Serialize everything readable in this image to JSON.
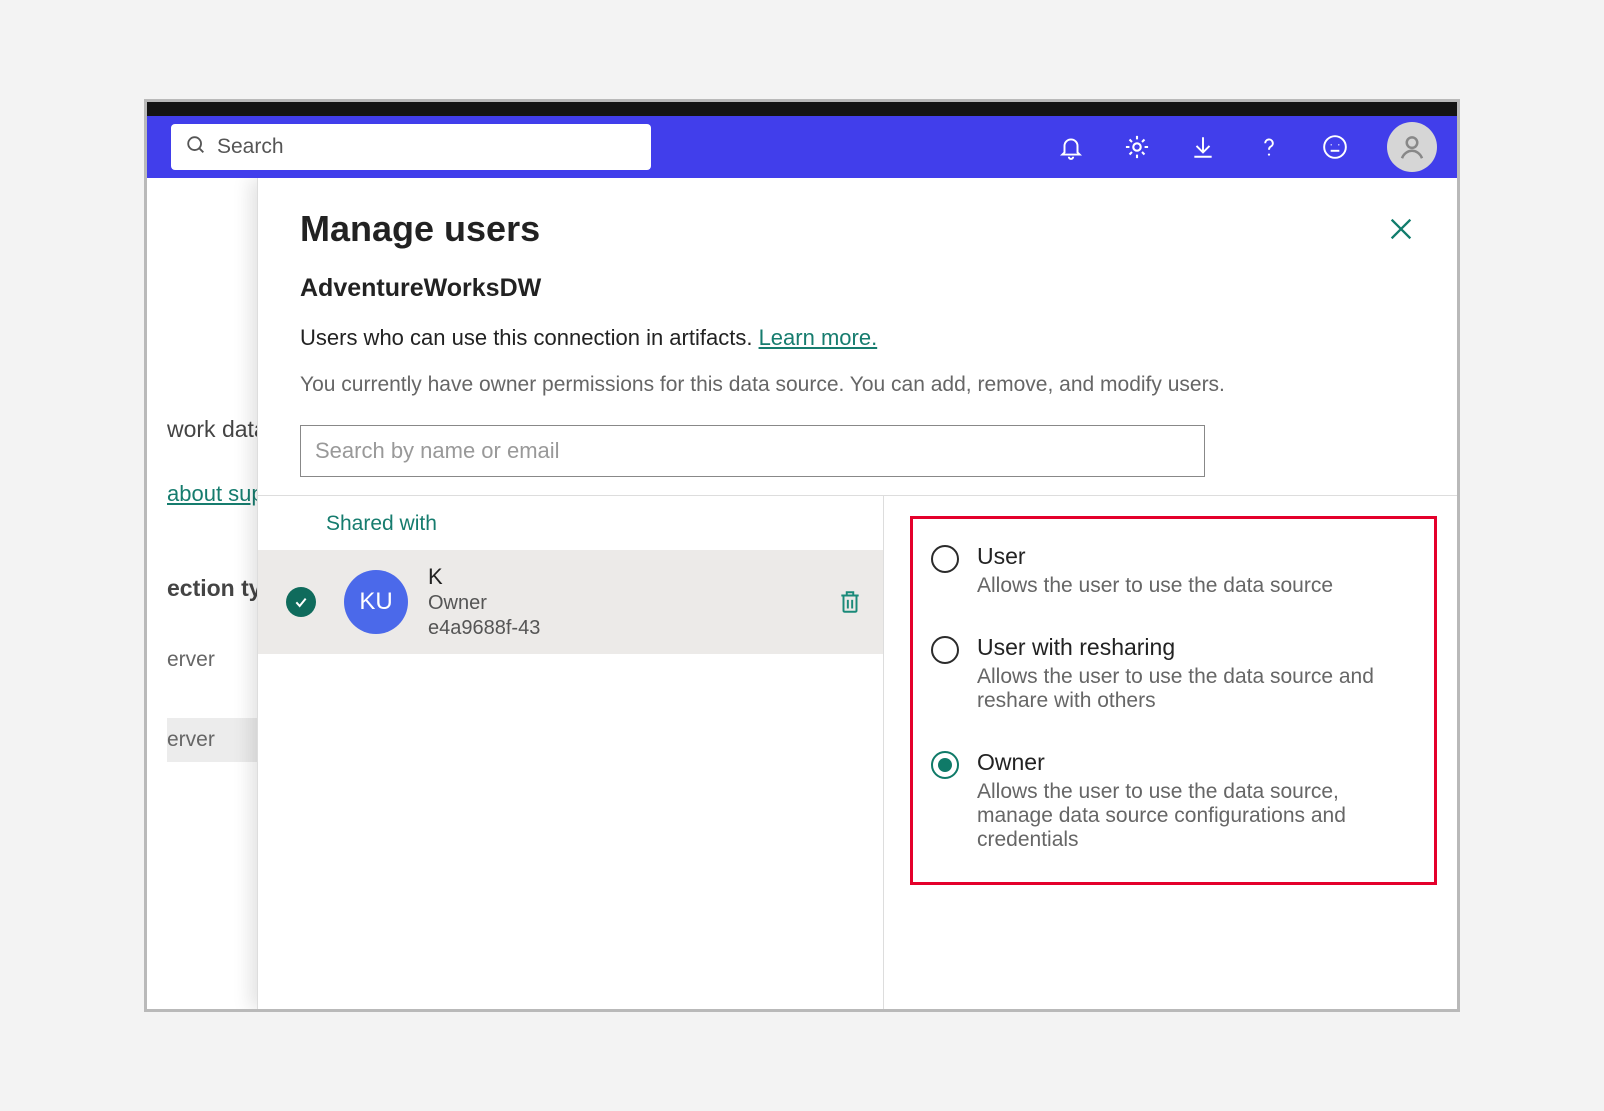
{
  "header": {
    "search_placeholder": "Search"
  },
  "bg": {
    "frag1": "work data g",
    "frag2": "about sup",
    "frag3": "ection typ",
    "frag4": "erver",
    "frag5": "erver"
  },
  "panel": {
    "title": "Manage users",
    "subtitle": "AdventureWorksDW",
    "desc_prefix": "Users who can use this connection in artifacts. ",
    "learn_more": "Learn more.",
    "note": "You currently have owner permissions for this data source. You can add, remove, and modify users.",
    "user_search_placeholder": "Search by name or email",
    "shared_with_label": "Shared with"
  },
  "user": {
    "initials": "KU",
    "name": "K",
    "role": "Owner",
    "id": "e4a9688f-43"
  },
  "roles": [
    {
      "title": "User",
      "desc": "Allows the user to use the data source",
      "selected": false
    },
    {
      "title": "User with resharing",
      "desc": "Allows the user to use the data source and reshare with others",
      "selected": false
    },
    {
      "title": "Owner",
      "desc": "Allows the user to use the data source, manage data source configurations and credentials",
      "selected": true
    }
  ]
}
